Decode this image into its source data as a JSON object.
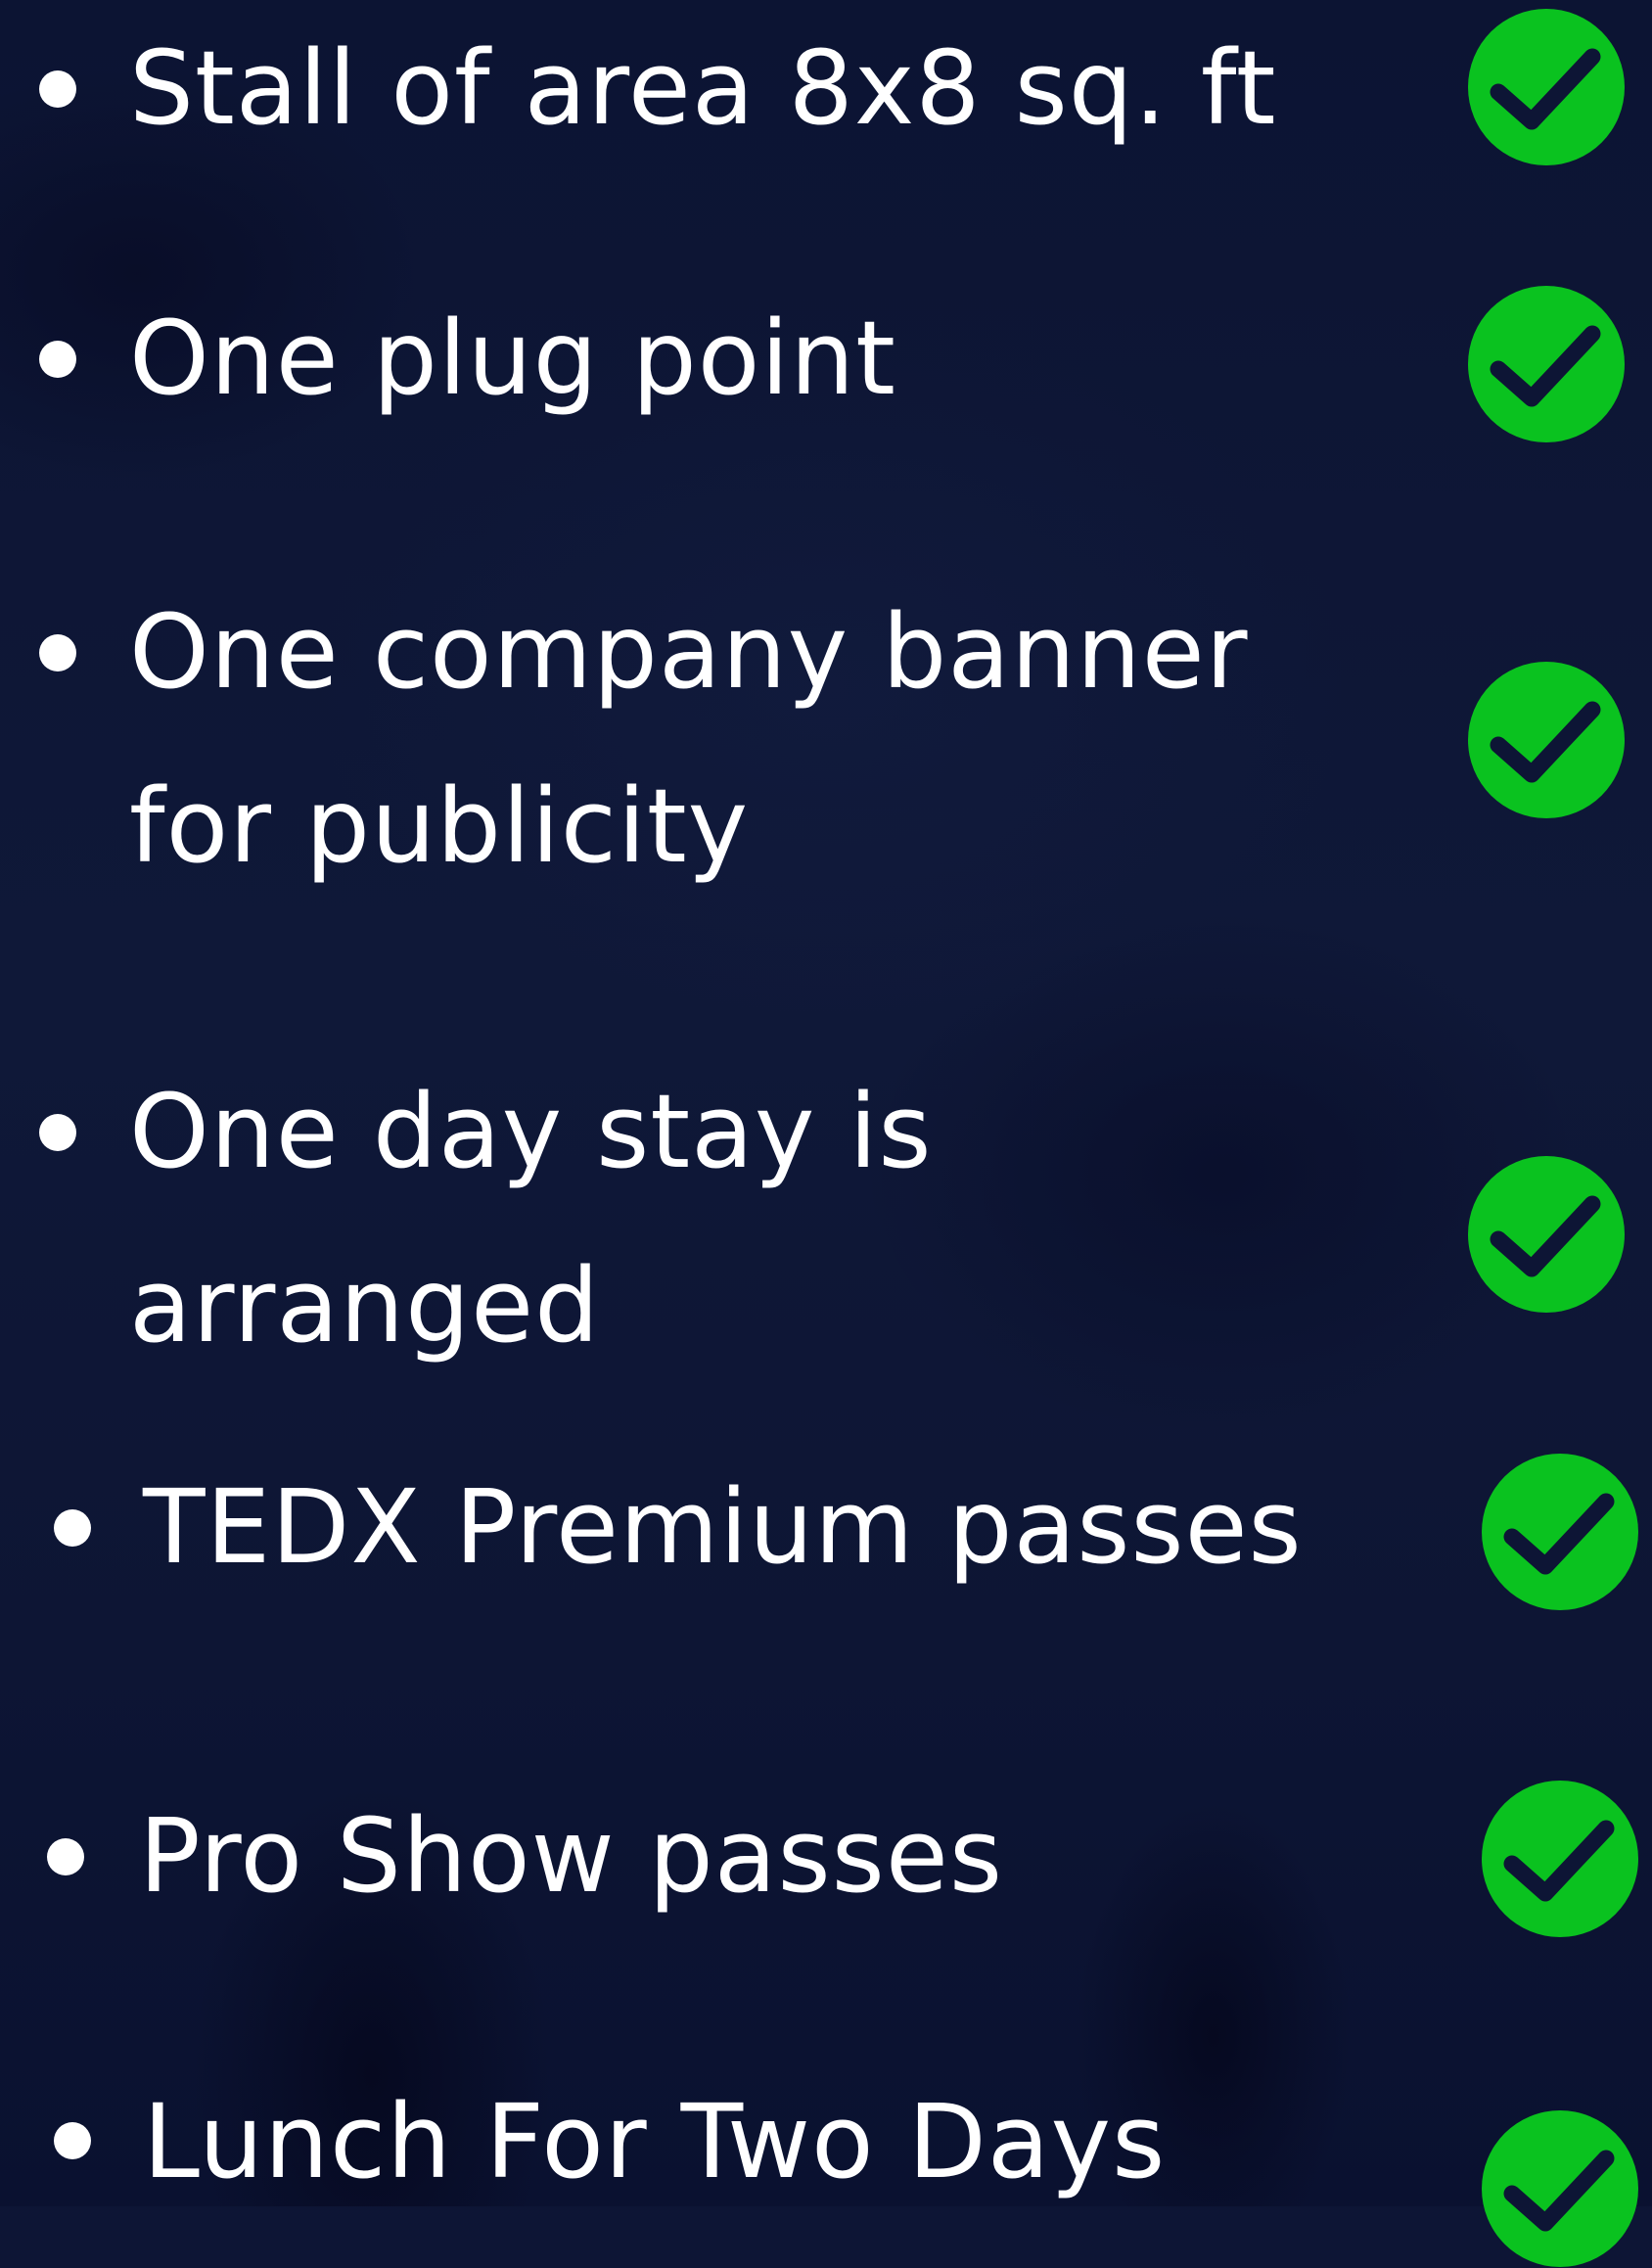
{
  "colors": {
    "background": "#0d1535",
    "text": "#ffffff",
    "check_fill": "#0ac21f",
    "check_mark": "#0d1535"
  },
  "icons": {
    "bullet": "bullet-dot",
    "status": "check-circle-icon"
  },
  "items": [
    {
      "lines": [
        "Stall of area 8x8 sq. ft"
      ]
    },
    {
      "lines": [
        "One plug point"
      ]
    },
    {
      "lines": [
        "One company banner",
        "for publicity"
      ]
    },
    {
      "lines": [
        "One day stay is",
        "arranged"
      ]
    },
    {
      "lines": [
        "TEDX Premium passes"
      ]
    },
    {
      "lines": [
        "Pro Show passes"
      ]
    },
    {
      "lines": [
        "Lunch For Two Days"
      ]
    }
  ]
}
